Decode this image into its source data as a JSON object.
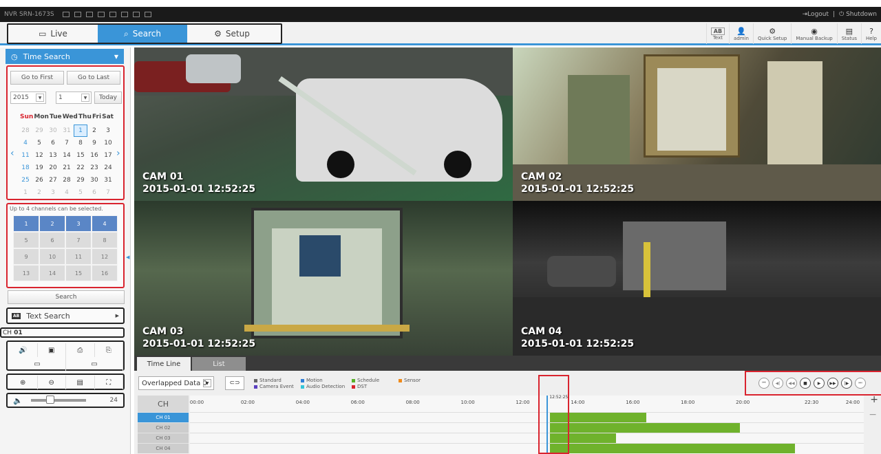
{
  "system": {
    "model": "NVR SRN-1673S",
    "logout": "Logout",
    "shutdown": "Shutdown"
  },
  "menu": {
    "tabs": [
      {
        "label": "Live",
        "icon": "monitor-icon"
      },
      {
        "label": "Search",
        "icon": "magnifier-icon"
      },
      {
        "label": "Setup",
        "icon": "gear-icon"
      }
    ],
    "tools": [
      {
        "label": "Text",
        "icon": "text-ab-icon"
      },
      {
        "label": "admin",
        "icon": "user-icon"
      },
      {
        "label": "Quick Setup",
        "icon": "quick-setup-icon"
      },
      {
        "label": "Manual Backup",
        "icon": "backup-icon"
      },
      {
        "label": "Status",
        "icon": "status-icon"
      },
      {
        "label": "Help",
        "icon": "help-icon"
      }
    ],
    "text_badge": "AB"
  },
  "left": {
    "time_search_title": "Time Search",
    "go_first": "Go to First",
    "go_last": "Go to Last",
    "year": "2015",
    "month": "1",
    "today": "Today",
    "weekdays": [
      "Sun",
      "Mon",
      "Tue",
      "Wed",
      "Thu",
      "Fri",
      "Sat"
    ],
    "days": [
      "28",
      "29",
      "30",
      "31",
      "1",
      "2",
      "3",
      "4",
      "5",
      "6",
      "7",
      "8",
      "9",
      "10",
      "11",
      "12",
      "13",
      "14",
      "15",
      "16",
      "17",
      "18",
      "19",
      "20",
      "21",
      "22",
      "23",
      "24",
      "25",
      "26",
      "27",
      "28",
      "29",
      "30",
      "31",
      "1",
      "2",
      "3",
      "4",
      "5",
      "6",
      "7"
    ],
    "selected_day_index": 4,
    "channel_note": "Up to 4 channels can be selected.",
    "channels": [
      "1",
      "2",
      "3",
      "4",
      "5",
      "6",
      "7",
      "8",
      "9",
      "10",
      "11",
      "12",
      "13",
      "14",
      "15",
      "16"
    ],
    "selected_channels": 4,
    "search": "Search",
    "text_search": "Text Search",
    "text_badge": "AB",
    "ch_prefix": "CH",
    "ch_value": "01",
    "volume": "24"
  },
  "cams": [
    {
      "name": "CAM 01",
      "time": "2015-01-01 12:52:25"
    },
    {
      "name": "CAM 02",
      "time": "2015-01-01 12:52:25"
    },
    {
      "name": "CAM 03",
      "time": "2015-01-01 12:52:25"
    },
    {
      "name": "CAM 04",
      "time": "2015-01-01 12:52:25"
    }
  ],
  "timeline": {
    "tabs": [
      "Time Line",
      "List"
    ],
    "overlapped": "Overlapped Data 0",
    "legend": [
      {
        "label": "Standard",
        "color": "#666666"
      },
      {
        "label": "Motion",
        "color": "#2f7fd8"
      },
      {
        "label": "Schedule",
        "color": "#59b12a"
      },
      {
        "label": "Sensor",
        "color": "#f08a1a"
      },
      {
        "label": "Camera Event",
        "color": "#5a3fbf"
      },
      {
        "label": "Audio Detection",
        "color": "#35c5d8"
      },
      {
        "label": "DST",
        "color": "#d9232e"
      }
    ],
    "ch_header": "CH",
    "rows": [
      "CH 01",
      "CH 02",
      "CH 03",
      "CH 04"
    ],
    "ticks": [
      "00:00",
      "02:00",
      "04:00",
      "06:00",
      "08:00",
      "10:00",
      "12:00",
      "14:00",
      "16:00",
      "18:00",
      "20:00",
      "22:30",
      "24:00"
    ],
    "cursor_time": "12:52:25",
    "cursor_hour": 12.87,
    "recordings": [
      {
        "row": 0,
        "start": 13.0,
        "end": 16.5
      },
      {
        "row": 1,
        "start": 13.0,
        "end": 19.9
      },
      {
        "row": 2,
        "start": 13.0,
        "end": 15.4
      },
      {
        "row": 3,
        "start": 13.0,
        "end": 21.9
      }
    ],
    "zoom_in": "+",
    "zoom_out": "−"
  }
}
